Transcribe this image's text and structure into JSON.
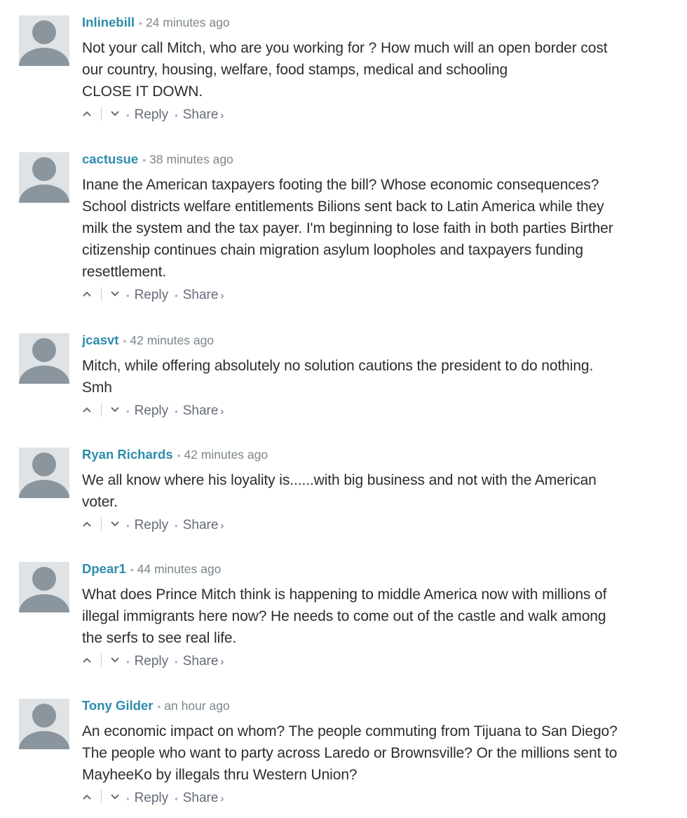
{
  "actions": {
    "reply": "Reply",
    "share": "Share",
    "share_chevron": "›"
  },
  "icons": {
    "avatar": "default-avatar-icon",
    "upvote": "chevron-up-icon",
    "downvote": "chevron-down-icon"
  },
  "colors": {
    "author": "#2e8cad",
    "meta": "#7b868c",
    "text": "#2a2e2e",
    "avatar_bg": "#dfe3e6",
    "avatar_fg": "#8a959e"
  },
  "comments": [
    {
      "author": "Inlinebill",
      "time": "24 minutes ago",
      "lines": [
        "Not your call Mitch, who are you working for ? How much will an open border cost",
        "our country, housing, welfare, food stamps, medical and schooling",
        "CLOSE IT DOWN."
      ]
    },
    {
      "author": "cactusue",
      "time": "38 minutes ago",
      "lines": [
        "Inane the American taxpayers footing the bill? Whose economic consequences?",
        "School districts welfare entitlements Bilions sent back to Latin America while they",
        "milk the system and the tax payer. I'm beginning to lose faith in both parties Birther",
        "citizenship continues chain migration asylum loopholes and taxpayers funding",
        "resettlement."
      ]
    },
    {
      "author": "jcasvt",
      "time": "42 minutes ago",
      "lines": [
        "Mitch, while offering absolutely no solution cautions the president to do nothing.",
        "Smh"
      ]
    },
    {
      "author": "Ryan Richards",
      "time": "42 minutes ago",
      "lines": [
        "We all know where his loyality is......with big business and not with the American",
        "voter."
      ]
    },
    {
      "author": "Dpear1",
      "time": "44 minutes ago",
      "lines": [
        "What does Prince Mitch think is happening to middle America now with millions of",
        "illegal immigrants here now? He needs to come out of the castle and walk among",
        "the serfs to see real life."
      ]
    },
    {
      "author": "Tony Gilder",
      "time": "an hour ago",
      "lines": [
        "An economic impact on whom? The people commuting from Tijuana to San Diego?",
        "The people who want to party across Laredo or Brownsville? Or the millions sent to",
        "MayheeKo by illegals thru Western Union?"
      ]
    }
  ]
}
